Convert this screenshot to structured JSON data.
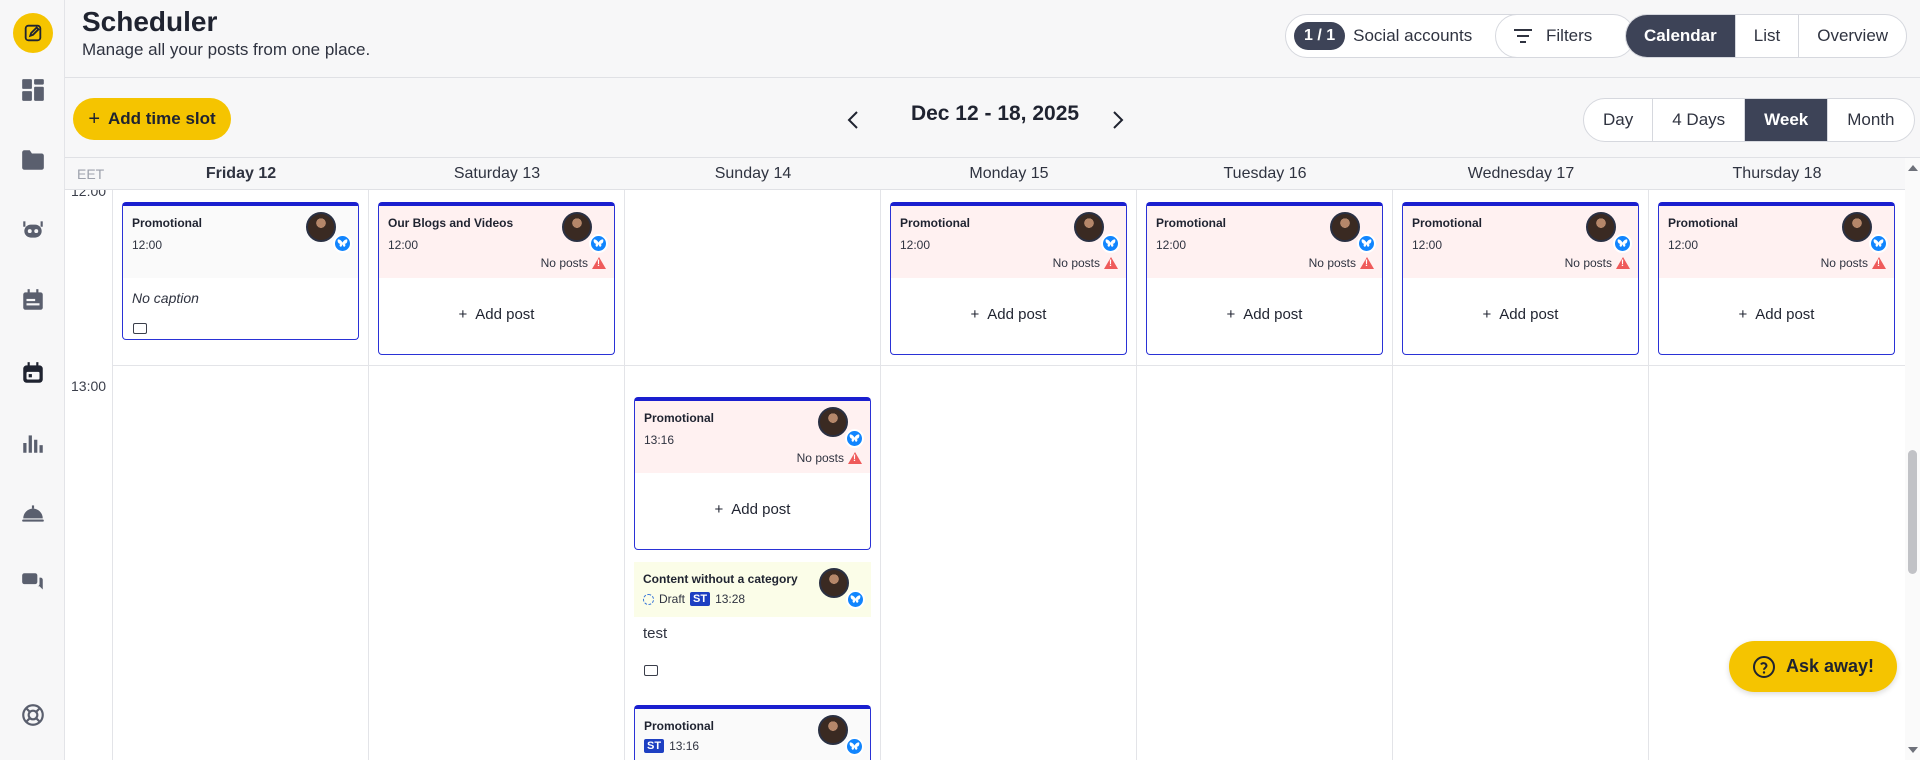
{
  "header": {
    "title": "Scheduler",
    "subtitle": "Manage all your posts from one place.",
    "accounts_count": "1 / 1",
    "accounts_label": "Social accounts",
    "filters_label": "Filters",
    "views": [
      "Calendar",
      "List",
      "Overview"
    ],
    "active_view": "Calendar"
  },
  "toolbar": {
    "add_slot_label": "Add time slot",
    "range_label": "Dec 12 - 18, 2025",
    "ranges": [
      "Day",
      "4 Days",
      "Week",
      "Month"
    ],
    "active_range": "Week"
  },
  "calendar": {
    "timezone": "EET",
    "days": [
      "Friday 12",
      "Saturday 13",
      "Sunday 14",
      "Monday 15",
      "Tuesday 16",
      "Wednesday 17",
      "Thursday 18"
    ],
    "today": "Friday 12",
    "time_labels": [
      "12:00",
      "13:00"
    ],
    "slots": [
      {
        "category": "Promotional",
        "time": "12:00",
        "caption": "No caption",
        "day": "Friday 12"
      },
      {
        "category": "Our Blogs and Videos",
        "time": "12:00",
        "status": "No posts",
        "action": "Add post",
        "day": "Saturday 13"
      },
      {
        "category": "Promotional",
        "time": "12:00",
        "status": "No posts",
        "action": "Add post",
        "day": "Monday 15"
      },
      {
        "category": "Promotional",
        "time": "12:00",
        "status": "No posts",
        "action": "Add post",
        "day": "Tuesday 16"
      },
      {
        "category": "Promotional",
        "time": "12:00",
        "status": "No posts",
        "action": "Add post",
        "day": "Wednesday 17"
      },
      {
        "category": "Promotional",
        "time": "12:00",
        "status": "No posts",
        "action": "Add post",
        "day": "Thursday 18"
      },
      {
        "category": "Promotional",
        "time": "13:16",
        "status": "No posts",
        "action": "Add post",
        "day": "Sunday 14"
      }
    ],
    "draft_post": {
      "category": "Content without a category",
      "status": "Draft",
      "badge": "ST",
      "time": "13:28",
      "caption": "test"
    },
    "last_post": {
      "category": "Promotional",
      "badge": "ST",
      "time": "13:16"
    }
  },
  "ask_label": "Ask away!",
  "colors": {
    "accent": "#f5c400",
    "dark": "#3d4357",
    "slot_border": "#1a1fcf",
    "bluesky": "#1185fe",
    "warning": "#ef5a5a"
  }
}
